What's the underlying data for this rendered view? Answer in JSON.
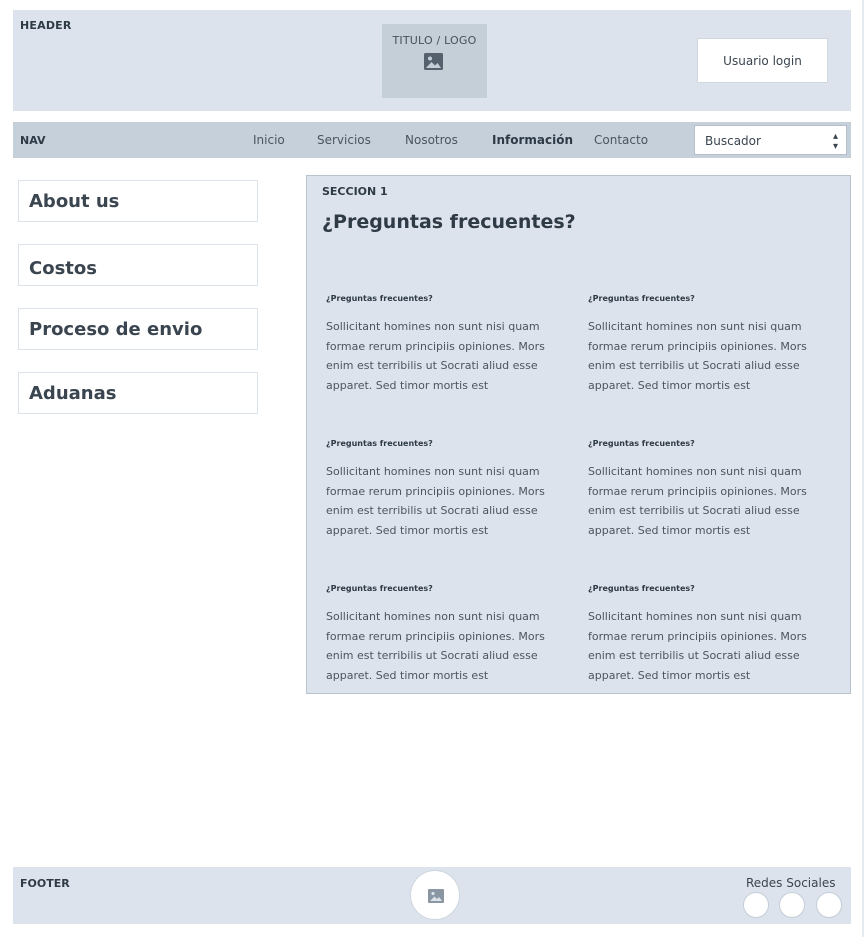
{
  "header": {
    "label": "HEADER",
    "logo_text": "TITULO / LOGO",
    "login_label": "Usuario login"
  },
  "nav": {
    "label": "NAV",
    "items": [
      {
        "label": "Inicio"
      },
      {
        "label": "Servicios"
      },
      {
        "label": "Nosotros"
      },
      {
        "label": "Información"
      },
      {
        "label": "Contacto"
      }
    ],
    "active": "Información",
    "search": {
      "value": "Buscador"
    }
  },
  "sidebar": {
    "items": [
      {
        "label": "About us"
      },
      {
        "label": "Costos"
      },
      {
        "label": "Proceso de envio"
      },
      {
        "label": "Aduanas"
      }
    ]
  },
  "section": {
    "label": "SECCION 1",
    "title": "¿Preguntas frecuentes?",
    "faqs": [
      {
        "question": "¿Preguntas frecuentes?",
        "answer": "Sollicitant homines non sunt nisi quam formae rerum principiis opiniones. Mors enim est terribilis ut Socrati aliud esse apparet. Sed timor mortis est"
      },
      {
        "question": "¿Preguntas frecuentes?",
        "answer": "Sollicitant homines non sunt nisi quam formae rerum principiis opiniones. Mors enim est terribilis ut Socrati aliud esse apparet. Sed timor mortis est"
      },
      {
        "question": "¿Preguntas frecuentes?",
        "answer": "Sollicitant homines non sunt nisi quam formae rerum principiis opiniones. Mors enim est terribilis ut Socrati aliud esse apparet. Sed timor mortis est"
      },
      {
        "question": "¿Preguntas frecuentes?",
        "answer": "Sollicitant homines non sunt nisi quam formae rerum principiis opiniones. Mors enim est terribilis ut Socrati aliud esse apparet. Sed timor mortis est"
      },
      {
        "question": "¿Preguntas frecuentes?",
        "answer": "Sollicitant homines non sunt nisi quam formae rerum principiis opiniones. Mors enim est terribilis ut Socrati aliud esse apparet. Sed timor mortis est"
      },
      {
        "question": "¿Preguntas frecuentes?",
        "answer": "Sollicitant homines non sunt nisi quam formae rerum principiis opiniones. Mors enim est terribilis ut Socrati aliud esse apparet. Sed timor mortis est"
      }
    ]
  },
  "footer": {
    "label": "FOOTER",
    "social_label": "Redes Sociales"
  },
  "icons": {
    "logo": "image-icon",
    "footer_logo": "image-icon",
    "select_arrows": "updown-arrows-icon"
  },
  "colors": {
    "header_bg": "#dde3ec",
    "nav_bg": "#c5d0da",
    "logo_bg": "#c5cfd8",
    "section_bg": "#dde3ec"
  }
}
